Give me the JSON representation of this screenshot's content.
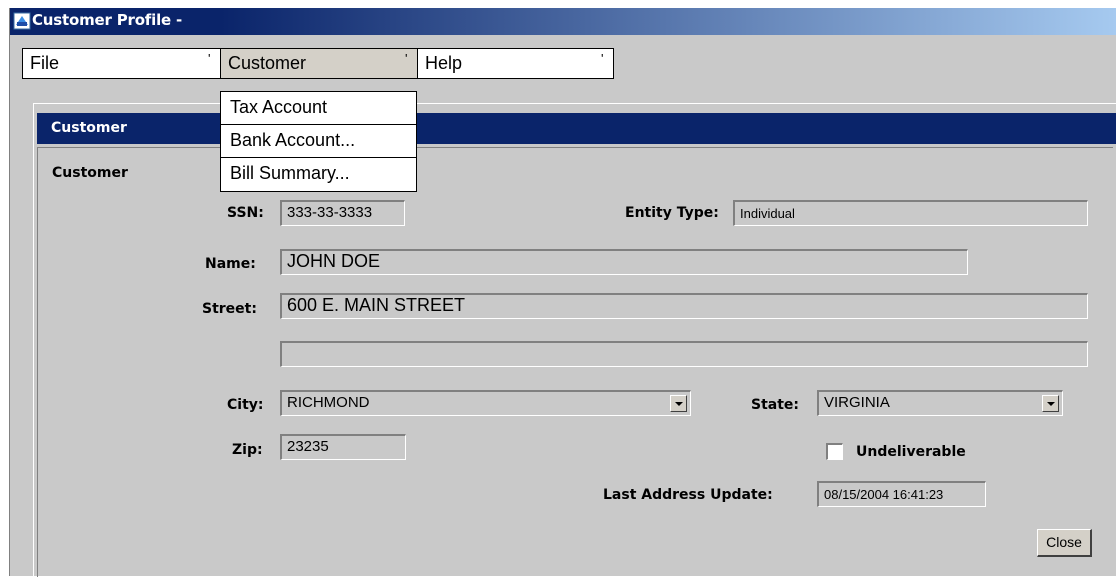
{
  "window": {
    "title": "Customer Profile -"
  },
  "menubar": {
    "items": [
      {
        "label": "File",
        "marker": "'"
      },
      {
        "label": "Customer",
        "marker": "'"
      },
      {
        "label": "Help",
        "marker": "'"
      }
    ]
  },
  "dropdown": {
    "items": [
      "Tax Account",
      "Bank Account...",
      "Bill Summary..."
    ]
  },
  "panel": {
    "header": "Customer",
    "section_label": "Customer"
  },
  "form": {
    "ssn_label": "SSN:",
    "ssn_value": "333-33-3333",
    "entity_type_label": "Entity Type:",
    "entity_type_value": "Individual",
    "name_label": "Name:",
    "name_value": "JOHN DOE",
    "street_label": "Street:",
    "street1_value": "600 E. MAIN STREET",
    "street2_value": "",
    "city_label": "City:",
    "city_value": "RICHMOND",
    "state_label": "State:",
    "state_value": "VIRGINIA",
    "zip_label": "Zip:",
    "zip_value": "23235",
    "undeliverable_label": "Undeliverable",
    "undeliverable_checked": false,
    "last_update_label": "Last Address Update:",
    "last_update_value": "08/15/2004 16:41:23"
  },
  "buttons": {
    "close": "Close"
  },
  "colors": {
    "title_bar": "#0a246a",
    "panel_header": "#0a246a",
    "background": "#c9c9c9"
  }
}
